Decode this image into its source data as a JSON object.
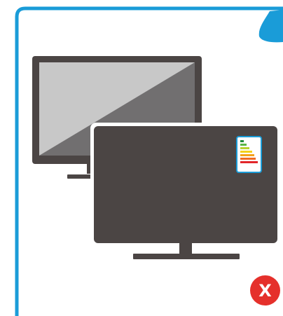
{
  "card": {
    "frame_color": "#1a9cd8",
    "corner_accent_color": "#1a9cd8",
    "icon": "tv-energy-label-icon"
  },
  "tv_back": {
    "icon": "flat-screen-tv-icon",
    "bezel_color": "#4b4544",
    "screen_light_color": "#c8c8c8",
    "screen_dark_color": "#716f70"
  },
  "tv_front": {
    "icon": "flat-screen-tv-icon",
    "body_color": "#4b4544"
  },
  "energy_label": {
    "icon": "energy-efficiency-label-icon",
    "border_color": "#1a9cd8",
    "bar_colors": [
      "#1f8a3c",
      "#5cb646",
      "#b9d330",
      "#f3d21b",
      "#f5a21b",
      "#ef6b22",
      "#e2262a"
    ]
  },
  "close_button": {
    "label": "X",
    "color": "#e5302b",
    "icon": "close-icon"
  }
}
